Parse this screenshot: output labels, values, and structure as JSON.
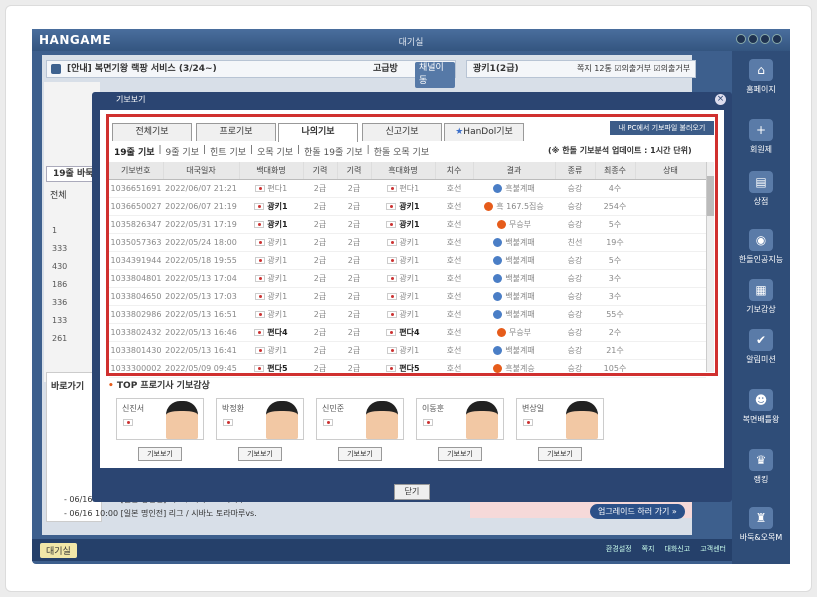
{
  "app": {
    "logo": "HANGAME",
    "window_title": "대기실"
  },
  "announcement": {
    "text": "[안내] 복면기왕 랙팡 서비스 (3/24~)",
    "grade": "고급방",
    "button": "채널이동"
  },
  "right_top": {
    "text": "광키1(2급)",
    "settings": "쪽지 12통 ☑의출거부 ☑의출거부"
  },
  "sidebar": [
    {
      "icon": "home-icon",
      "label": "홈페이지"
    },
    {
      "icon": "plus-icon",
      "label": "회원제"
    },
    {
      "icon": "shop-icon",
      "label": "상점"
    },
    {
      "icon": "ai-icon",
      "label": "한돌인공지능"
    },
    {
      "icon": "watch-icon",
      "label": "기보감상"
    },
    {
      "icon": "mission-icon",
      "label": "알림미션"
    },
    {
      "icon": "mask-icon",
      "label": "복면배틀왕"
    },
    {
      "icon": "rank-icon",
      "label": "랭킹"
    },
    {
      "icon": "tour-icon",
      "label": "바둑&오목M"
    }
  ],
  "left": {
    "tab": "19줄 바둑",
    "sub": "전체",
    "rows": [
      "1",
      "333",
      "430",
      "186",
      "336",
      "133",
      "261"
    ],
    "bottom_title": "바로가기"
  },
  "ticker": {
    "line1": "- 06/16 10:00 [일본 명인전] 리그 / 시바노 토라마루vs.",
    "line2": "- 06/16 10:00 [일본 명인전] 리그 / 시바노 토라마루vs."
  },
  "upgrade_button": "업그레이드 하러 가기 »",
  "status": {
    "waiting": "대기실",
    "links": [
      "환경설정",
      "쪽지",
      "대화신고",
      "고객센터"
    ]
  },
  "modal": {
    "title": "기보보기",
    "tabs": [
      "전체기보",
      "프로기보",
      "나의기보",
      "신고기보",
      "HanDol기보"
    ],
    "pc_button": "내 PC에서 기보파일 불러오기",
    "subtabs": [
      "19줄 기보",
      "9줄 기보",
      "힌트 기보",
      "오목 기보",
      "한돌 19줄 기보",
      "한돌 오목 기보"
    ],
    "notice": "(※ 한돌 기보분석 업데이트 : 1시간 단위)",
    "columns": [
      "기보번호",
      "대국일자",
      "백대화명",
      "기력",
      "기력",
      "흑대화명",
      "치수",
      "결과",
      "종류",
      "최종수",
      "상태"
    ],
    "rows": [
      [
        "1036651691",
        "2022/06/07 21:21",
        "편다1",
        "2급",
        "2급",
        "편다1",
        "호선",
        "흑불계패",
        "승강",
        "4수",
        ""
      ],
      [
        "1036650027",
        "2022/06/07 21:19",
        "광키1",
        "2급",
        "2급",
        "광키1",
        "호선",
        "흑 167.5집승",
        "승강",
        "254수",
        ""
      ],
      [
        "1035826347",
        "2022/05/31 17:19",
        "광키1",
        "2급",
        "2급",
        "광키1",
        "호선",
        "무승부",
        "승강",
        "5수",
        ""
      ],
      [
        "1035057363",
        "2022/05/24 18:00",
        "광키1",
        "2급",
        "2급",
        "광키1",
        "호선",
        "백불계패",
        "친선",
        "19수",
        ""
      ],
      [
        "1034391944",
        "2022/05/18 19:55",
        "광키1",
        "2급",
        "2급",
        "광키1",
        "호선",
        "백불계패",
        "승강",
        "5수",
        ""
      ],
      [
        "1033804801",
        "2022/05/13 17:04",
        "광키1",
        "2급",
        "2급",
        "광키1",
        "호선",
        "백불계패",
        "승강",
        "3수",
        ""
      ],
      [
        "1033804650",
        "2022/05/13 17:03",
        "광키1",
        "2급",
        "2급",
        "광키1",
        "호선",
        "백불계패",
        "승강",
        "3수",
        ""
      ],
      [
        "1033802986",
        "2022/05/13 16:51",
        "광키1",
        "2급",
        "2급",
        "광키1",
        "호선",
        "백불계패",
        "승강",
        "55수",
        ""
      ],
      [
        "1033802432",
        "2022/05/13 16:46",
        "편다4",
        "2급",
        "2급",
        "편다4",
        "호선",
        "무승부",
        "승강",
        "2수",
        ""
      ],
      [
        "1033801430",
        "2022/05/13 16:41",
        "광키1",
        "2급",
        "2급",
        "광키1",
        "호선",
        "백불계패",
        "승강",
        "21수",
        ""
      ],
      [
        "1033300002",
        "2022/05/09 09:45",
        "편다5",
        "2급",
        "2급",
        "편다5",
        "호선",
        "흑불계승",
        "승강",
        "105수",
        ""
      ]
    ],
    "top_title": "TOP 프로기사 기보감상",
    "pros": [
      "신진서",
      "박정환",
      "신민준",
      "이동훈",
      "변상일"
    ],
    "pro_button": "기보보기",
    "close": "닫기"
  }
}
